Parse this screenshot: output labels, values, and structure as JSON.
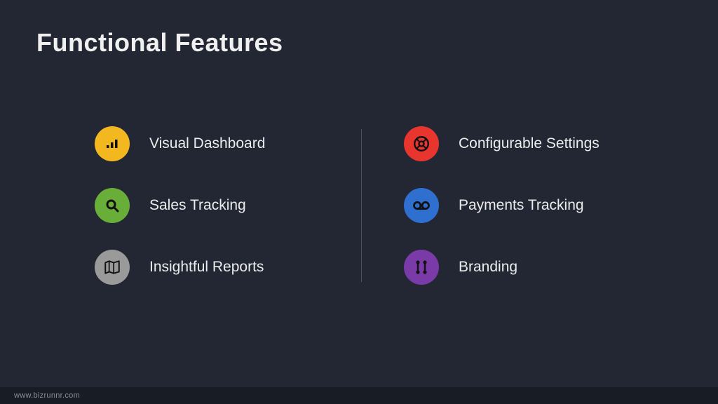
{
  "title": "Functional Features",
  "left": [
    {
      "label": "Visual Dashboard"
    },
    {
      "label": "Sales Tracking"
    },
    {
      "label": "Insightful Reports"
    }
  ],
  "right": [
    {
      "label": "Configurable Settings"
    },
    {
      "label": "Payments Tracking"
    },
    {
      "label": "Branding"
    }
  ],
  "colors": {
    "yellow": "#f3b81f",
    "green": "#6aae3a",
    "gray": "#9a9a9a",
    "red": "#e8352e",
    "blue": "#2f6fd0",
    "purple": "#7a3aa8"
  },
  "footer": "www.bizrunnr.com"
}
